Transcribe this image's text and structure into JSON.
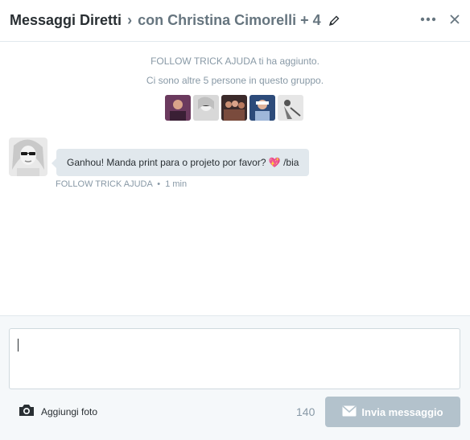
{
  "header": {
    "title": "Messaggi Diretti",
    "separator": "›",
    "conversation": "con Christina Cimorelli + 4",
    "edit_icon": "pencil-icon",
    "more_icon": "more-dots-icon",
    "close_icon": "close-icon"
  },
  "system": {
    "added_notice": "FOLLOW TRICK AJUDA ti ha aggiunto.",
    "group_notice": "Ci sono altre 5 persone in questo gruppo."
  },
  "members": [
    {
      "name": "member-1",
      "color": "#6b3a5e"
    },
    {
      "name": "member-2",
      "color": "#cfcfcf"
    },
    {
      "name": "member-3",
      "color": "#3b2a2a"
    },
    {
      "name": "member-4",
      "color": "#2d4b7a"
    },
    {
      "name": "member-5",
      "color": "#dedede"
    }
  ],
  "messages": [
    {
      "text": "Ganhou! Manda print para o projeto por favor? 💖 /bia",
      "sender": "FOLLOW TRICK AJUDA",
      "separator": "•",
      "time": "1 min"
    }
  ],
  "composer": {
    "value": "",
    "add_photo_label": "Aggiungi foto",
    "char_count": "140",
    "send_label": "Invia messaggio",
    "camera_icon": "camera-icon",
    "send_icon": "envelope-icon"
  },
  "colors": {
    "send_disabled": "#b3c2cc",
    "bubble": "#e1e8ed",
    "muted": "#8899a6"
  }
}
